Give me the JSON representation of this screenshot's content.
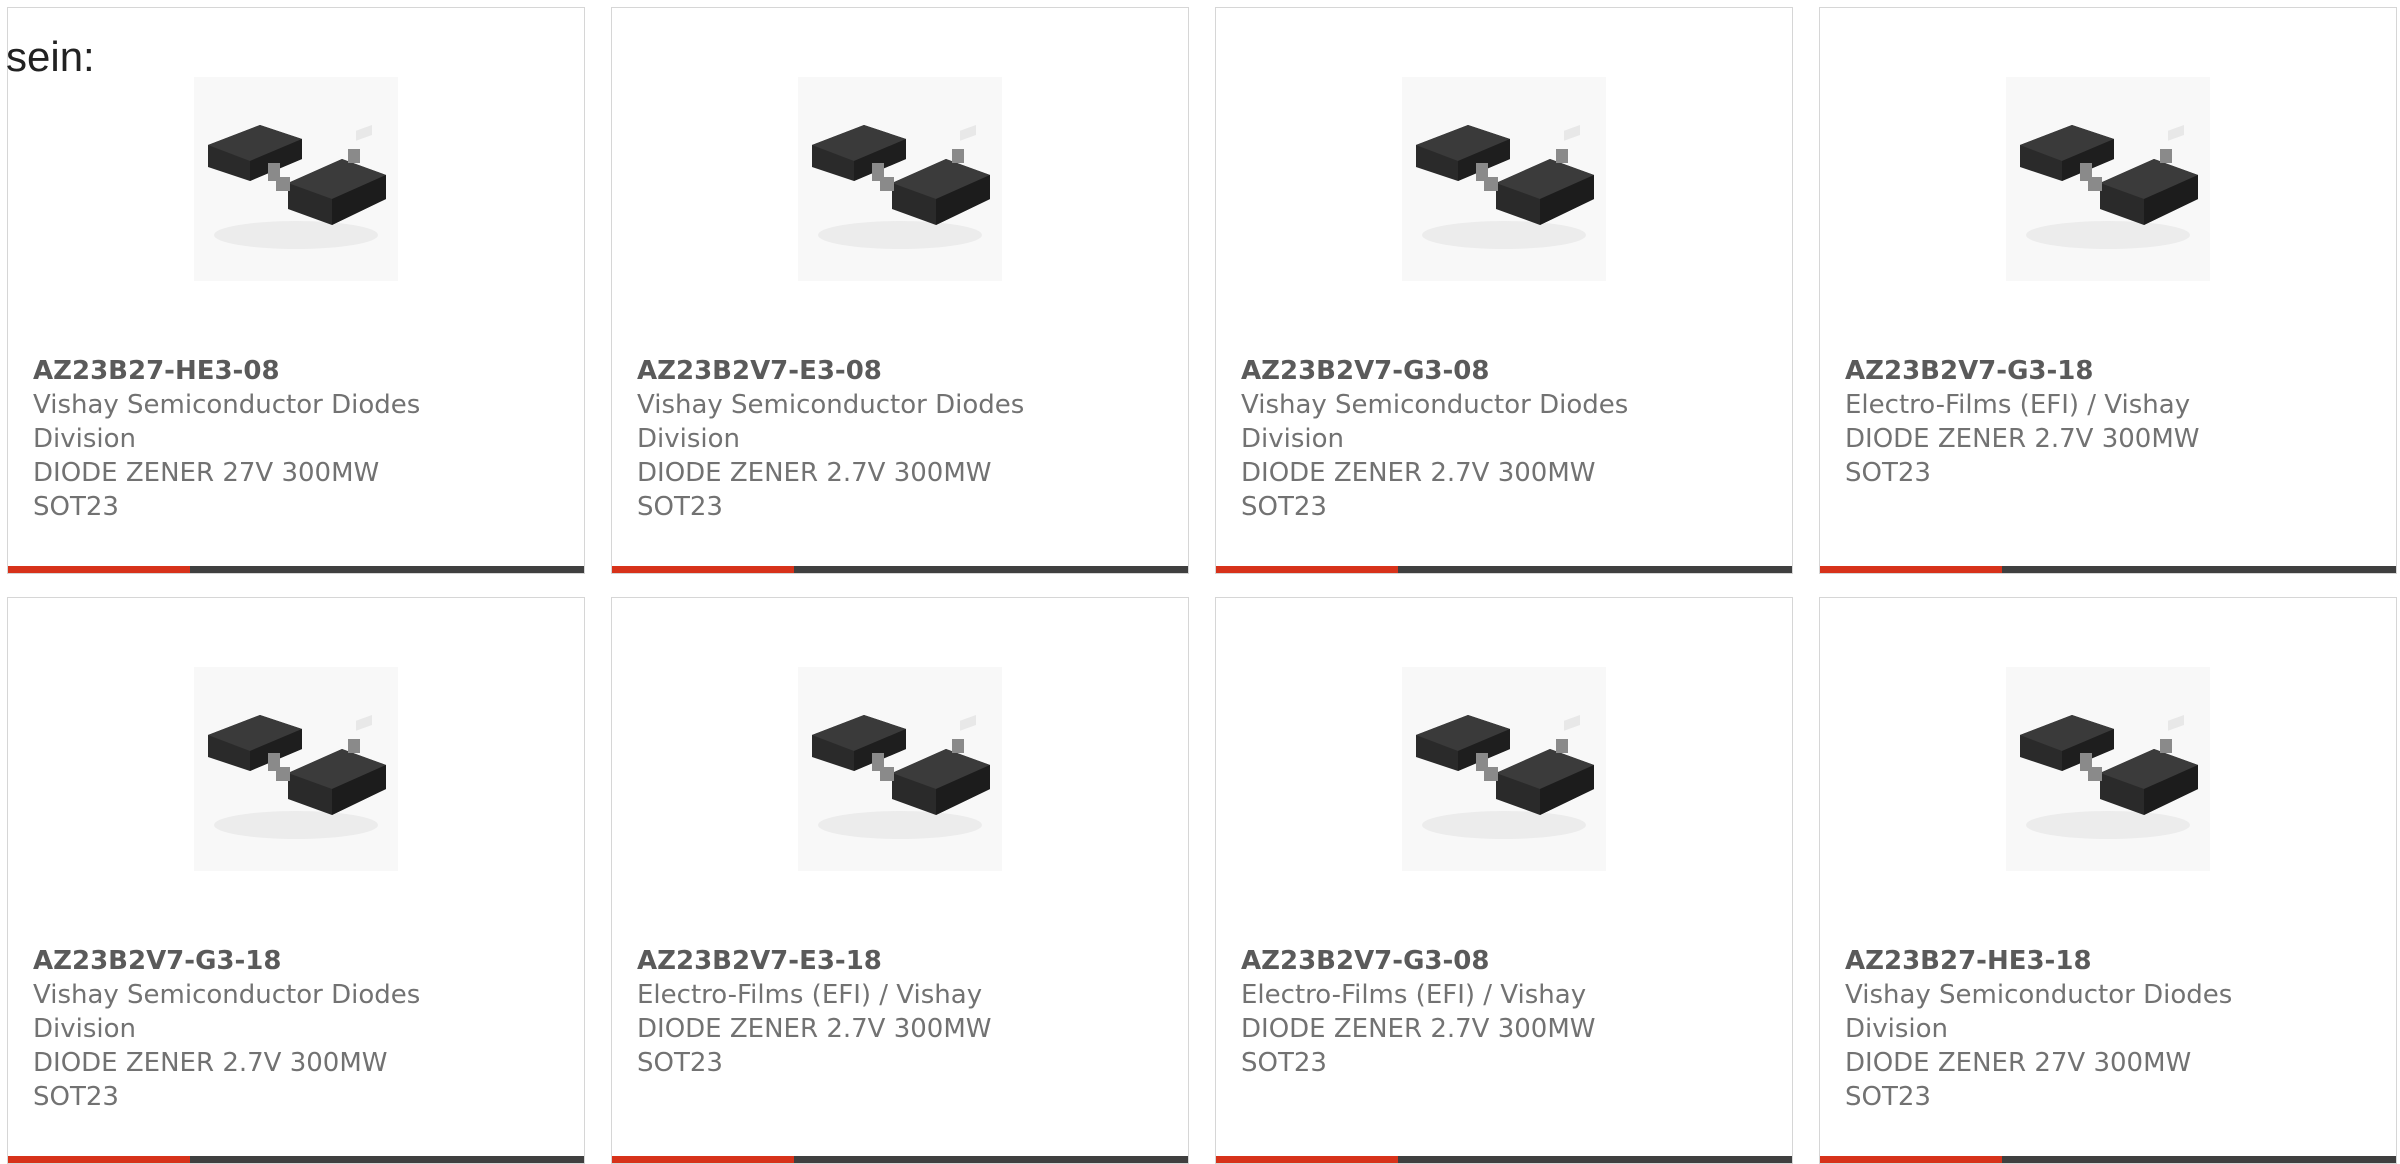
{
  "lead_text": "sein:",
  "colors": {
    "accent": "#d7321a",
    "bar": "#3f3f3f",
    "border": "#d6d6d6",
    "text": "#727272"
  },
  "products": [
    {
      "part": "AZ23B27-HE3-08",
      "maker": [
        "Vishay Semiconductor Diodes",
        "Division"
      ],
      "desc": [
        "DIODE ZENER 27V 300MW",
        "SOT23"
      ]
    },
    {
      "part": "AZ23B2V7-E3-08",
      "maker": [
        "Vishay Semiconductor Diodes",
        "Division"
      ],
      "desc": [
        "DIODE ZENER 2.7V 300MW",
        "SOT23"
      ]
    },
    {
      "part": "AZ23B2V7-G3-08",
      "maker": [
        "Vishay Semiconductor Diodes",
        "Division"
      ],
      "desc": [
        "DIODE ZENER 2.7V 300MW",
        "SOT23"
      ]
    },
    {
      "part": "AZ23B2V7-G3-18",
      "maker": [
        "Electro-Films (EFI) / Vishay"
      ],
      "desc": [
        "DIODE ZENER 2.7V 300MW",
        "SOT23"
      ]
    },
    {
      "part": "AZ23B2V7-G3-18",
      "maker": [
        "Vishay Semiconductor Diodes",
        "Division"
      ],
      "desc": [
        "DIODE ZENER 2.7V 300MW",
        "SOT23"
      ]
    },
    {
      "part": "AZ23B2V7-E3-18",
      "maker": [
        "Electro-Films (EFI) / Vishay"
      ],
      "desc": [
        "DIODE ZENER 2.7V 300MW",
        "SOT23"
      ]
    },
    {
      "part": "AZ23B2V7-G3-08",
      "maker": [
        "Electro-Films (EFI) / Vishay"
      ],
      "desc": [
        "DIODE ZENER 2.7V 300MW",
        "SOT23"
      ]
    },
    {
      "part": "AZ23B27-HE3-18",
      "maker": [
        "Vishay Semiconductor Diodes",
        "Division"
      ],
      "desc": [
        "DIODE ZENER 27V 300MW",
        "SOT23"
      ]
    }
  ]
}
